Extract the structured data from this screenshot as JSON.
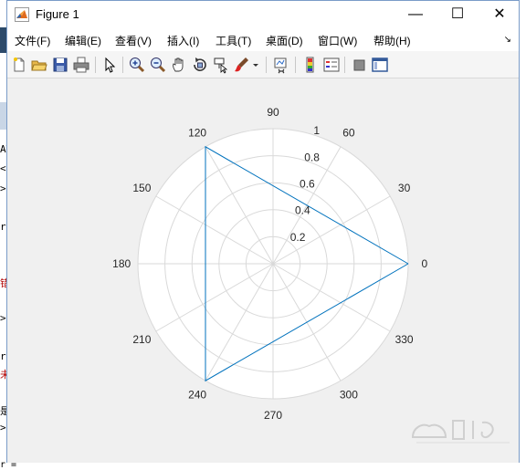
{
  "window": {
    "title": "Figure 1"
  },
  "window_controls": {
    "minimize": "—",
    "maximize": "☐",
    "close": "✕"
  },
  "menu": {
    "items": [
      {
        "label": "文件(F)"
      },
      {
        "label": "编辑(E)"
      },
      {
        "label": "查看(V)"
      },
      {
        "label": "插入(I)"
      },
      {
        "label": "工具(T)"
      },
      {
        "label": "桌面(D)"
      },
      {
        "label": "窗口(W)"
      },
      {
        "label": "帮助(H)"
      }
    ],
    "corner": "↘"
  },
  "background_console": {
    "lines": [
      "AT",
      "<",
      ">",
      "r",
      "错",
      ">",
      "r",
      "未",
      "是",
      ">",
      "r ="
    ]
  },
  "chart_data": {
    "type": "polar-line",
    "theta_ticks": [
      "0",
      "30",
      "60",
      "90",
      "120",
      "150",
      "180",
      "210",
      "240",
      "270",
      "300",
      "330"
    ],
    "r_ticks": [
      "0.2",
      "0.4",
      "0.6",
      "0.8",
      "1"
    ],
    "rlim": [
      0,
      1
    ],
    "grid": true,
    "series": [
      {
        "theta_deg": [
          0,
          120,
          240,
          0
        ],
        "r": [
          1,
          1,
          1,
          1
        ],
        "color": "#0072bd"
      }
    ],
    "grid_color": "#d9d9d9",
    "axes_bg": "#ffffff"
  },
  "colors": {
    "accent_border": "#7a9cc8",
    "line": "#0072bd"
  }
}
